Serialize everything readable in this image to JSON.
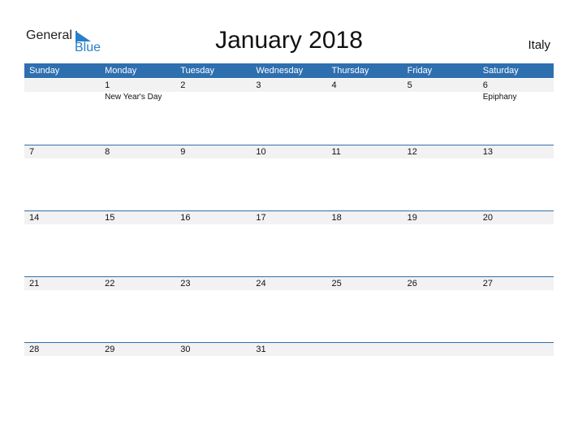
{
  "logo": {
    "general": "General",
    "blue": "Blue"
  },
  "title": "January 2018",
  "country": "Italy",
  "colors": {
    "accent": "#2e6fb0",
    "strip": "#f2f2f2"
  },
  "weekdays": [
    "Sunday",
    "Monday",
    "Tuesday",
    "Wednesday",
    "Thursday",
    "Friday",
    "Saturday"
  ],
  "weeks": [
    {
      "days": [
        "",
        "1",
        "2",
        "3",
        "4",
        "5",
        "6"
      ],
      "events": [
        "",
        "New Year's Day",
        "",
        "",
        "",
        "",
        "Epiphany"
      ]
    },
    {
      "days": [
        "7",
        "8",
        "9",
        "10",
        "11",
        "12",
        "13"
      ],
      "events": [
        "",
        "",
        "",
        "",
        "",
        "",
        ""
      ]
    },
    {
      "days": [
        "14",
        "15",
        "16",
        "17",
        "18",
        "19",
        "20"
      ],
      "events": [
        "",
        "",
        "",
        "",
        "",
        "",
        ""
      ]
    },
    {
      "days": [
        "21",
        "22",
        "23",
        "24",
        "25",
        "26",
        "27"
      ],
      "events": [
        "",
        "",
        "",
        "",
        "",
        "",
        ""
      ]
    },
    {
      "days": [
        "28",
        "29",
        "30",
        "31",
        "",
        "",
        ""
      ],
      "events": [
        "",
        "",
        "",
        "",
        "",
        "",
        ""
      ]
    }
  ]
}
